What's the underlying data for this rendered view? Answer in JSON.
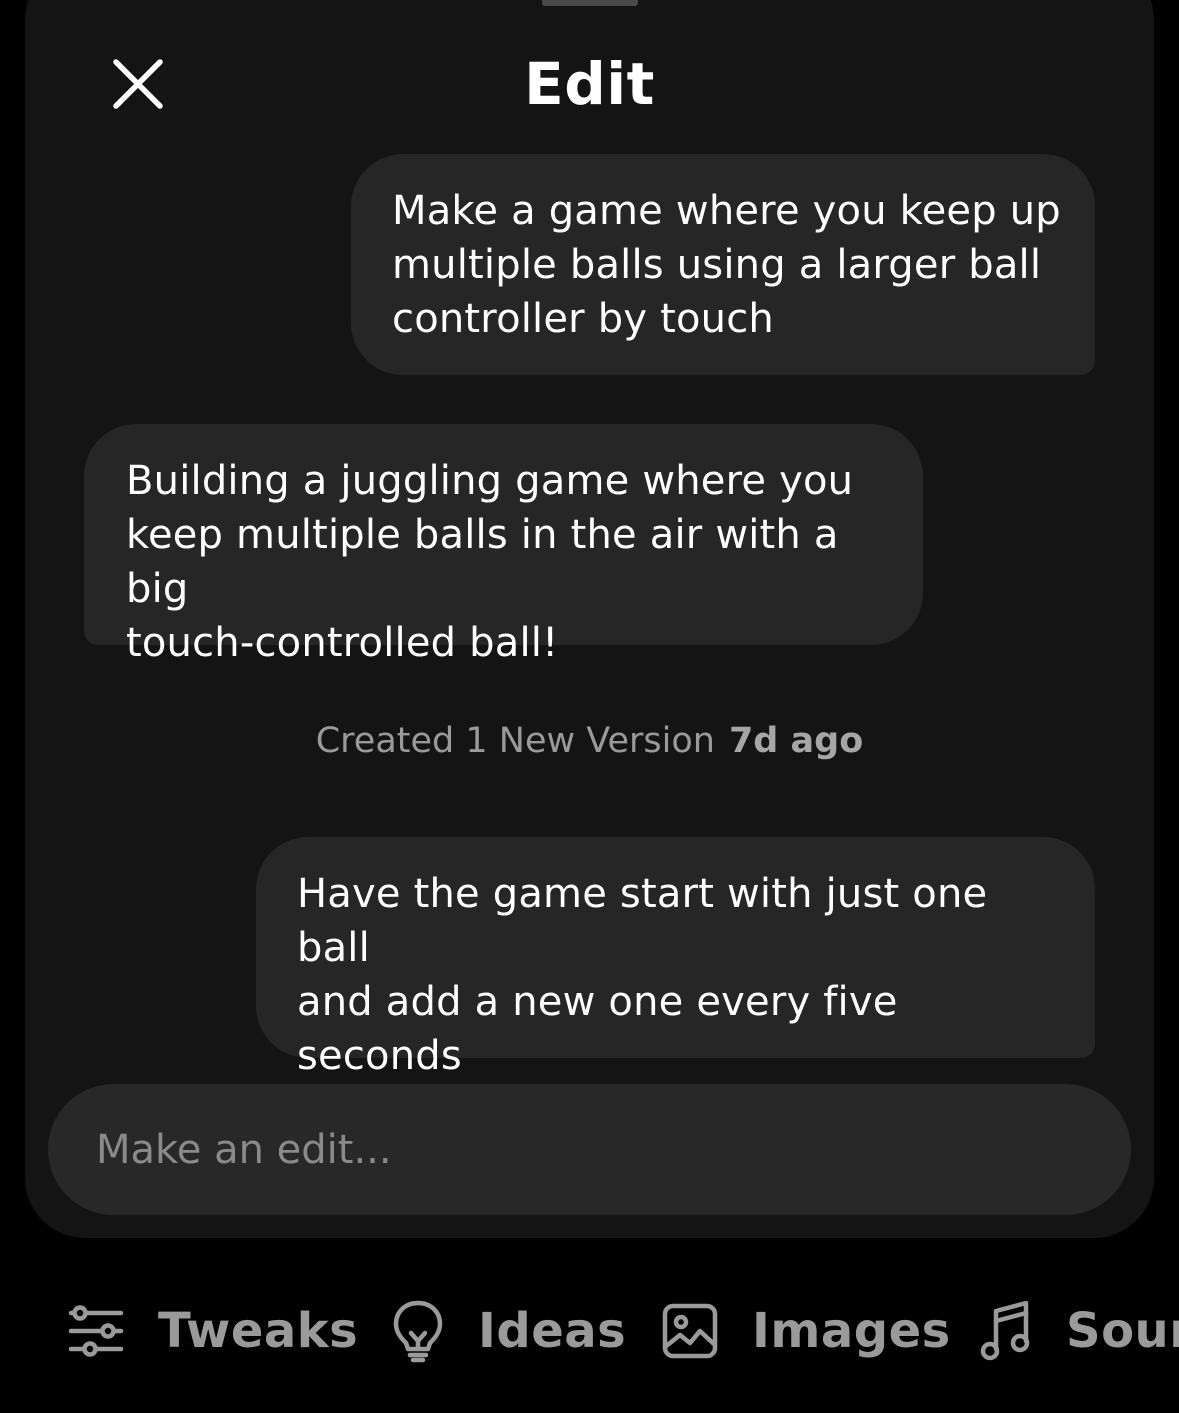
{
  "header": {
    "title": "Edit",
    "close_icon": "close-icon"
  },
  "messages": [
    {
      "role": "user",
      "text": "Make a game where you keep up\nmultiple balls using a larger ball\ncontroller by touch"
    },
    {
      "role": "assistant",
      "text": "Building a juggling game where you\nkeep multiple balls in the air with a big\ntouch-controlled ball!"
    },
    {
      "role": "user",
      "text": "Have the game start with just one ball\nand add a new one every five\nseconds"
    }
  ],
  "version_note": {
    "text": "Created 1 New Version",
    "time": "7d ago"
  },
  "composer": {
    "placeholder": "Make an edit...",
    "value": ""
  },
  "toolbar": {
    "items": [
      {
        "label": "Tweaks",
        "icon": "sliders-icon"
      },
      {
        "label": "Ideas",
        "icon": "lightbulb-icon"
      },
      {
        "label": "Images",
        "icon": "image-icon"
      },
      {
        "label": "Soun",
        "icon": "music-note-icon"
      }
    ]
  },
  "colors": {
    "background": "#000000",
    "sheet": "#141414",
    "bubble": "#262626",
    "muted_text": "#9a9a9a"
  }
}
